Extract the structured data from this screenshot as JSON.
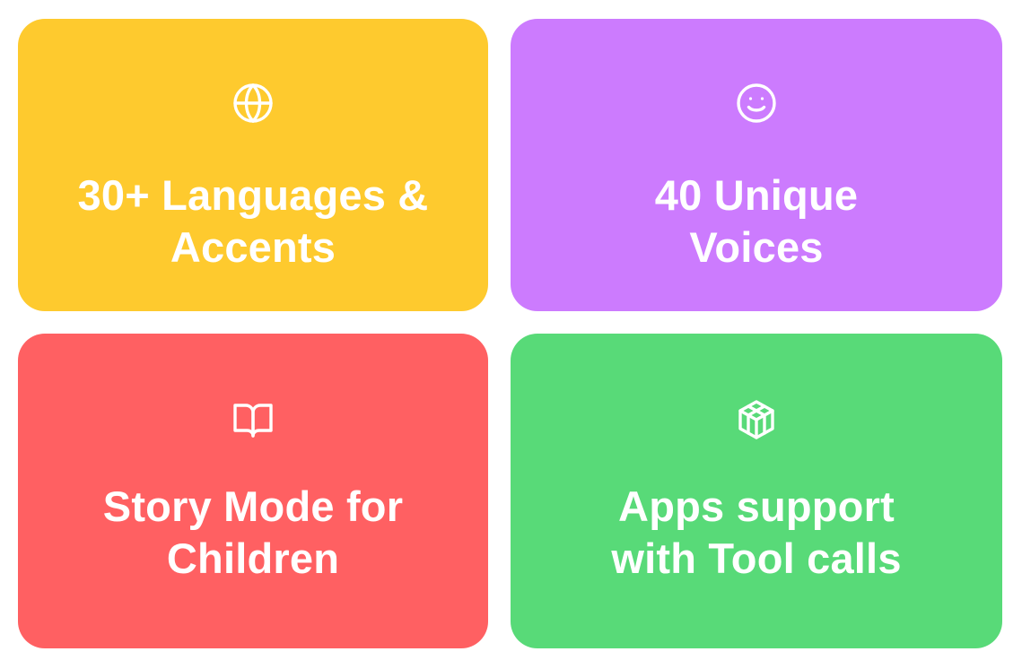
{
  "cards": [
    {
      "color": "#FECA2E",
      "icon": "globe-icon",
      "title_lines": [
        "30+ Languages &",
        "Accents"
      ]
    },
    {
      "color": "#CC7BFE",
      "icon": "smiley-face-icon",
      "title_lines": [
        "40 Unique",
        "Voices"
      ]
    },
    {
      "color": "#FF6062",
      "icon": "open-book-icon",
      "title_lines": [
        "Story Mode for",
        "Children"
      ]
    },
    {
      "color": "#58DA78",
      "icon": "cube-box-icon",
      "title_lines": [
        "Apps support",
        "with Tool calls"
      ]
    }
  ]
}
